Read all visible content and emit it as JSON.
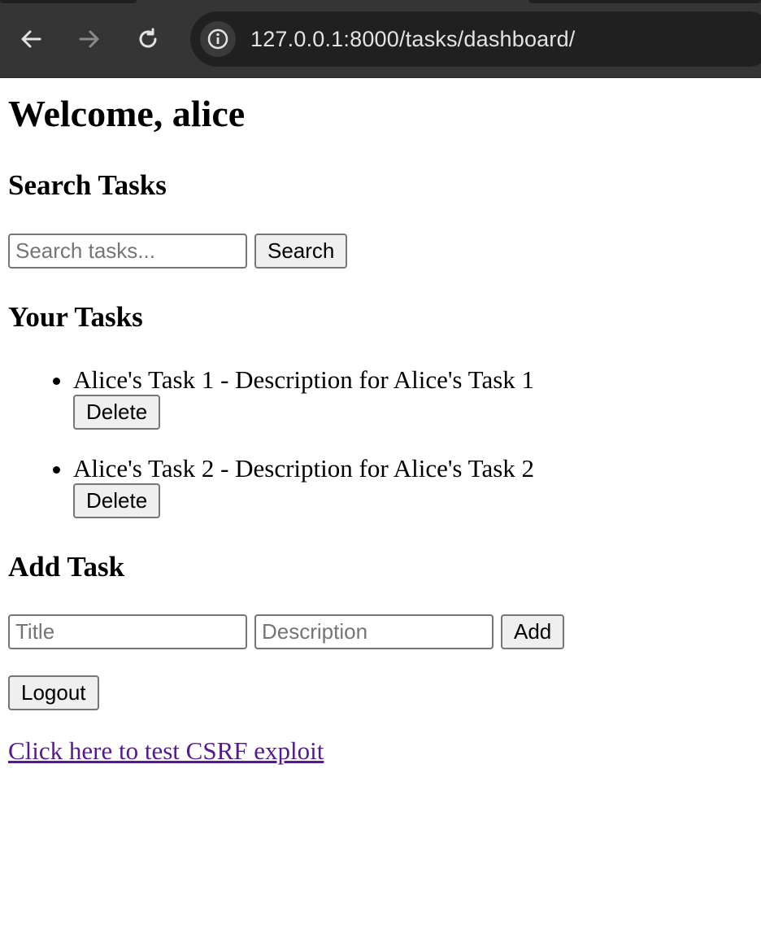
{
  "browser": {
    "url": "127.0.0.1:8000/tasks/dashboard/",
    "icons": {
      "back": "arrow-left-icon",
      "forward": "arrow-right-icon",
      "reload": "reload-icon",
      "site_info": "info-icon"
    }
  },
  "page": {
    "title": "Welcome, alice",
    "search": {
      "heading": "Search Tasks",
      "placeholder": "Search tasks...",
      "button": "Search"
    },
    "tasks": {
      "heading": "Your Tasks",
      "items": [
        {
          "text": "Alice's Task 1 - Description for Alice's Task 1",
          "delete_label": "Delete"
        },
        {
          "text": "Alice's Task 2 - Description for Alice's Task 2",
          "delete_label": "Delete"
        }
      ]
    },
    "add": {
      "heading": "Add Task",
      "title_placeholder": "Title",
      "description_placeholder": "Description",
      "button": "Add"
    },
    "logout_label": "Logout",
    "csrf_link": "Click here to test CSRF exploit"
  },
  "colors": {
    "chrome_bg": "#353535",
    "address_bg": "#202020",
    "visited_link": "#551a8b",
    "button_bg": "#efefef"
  }
}
